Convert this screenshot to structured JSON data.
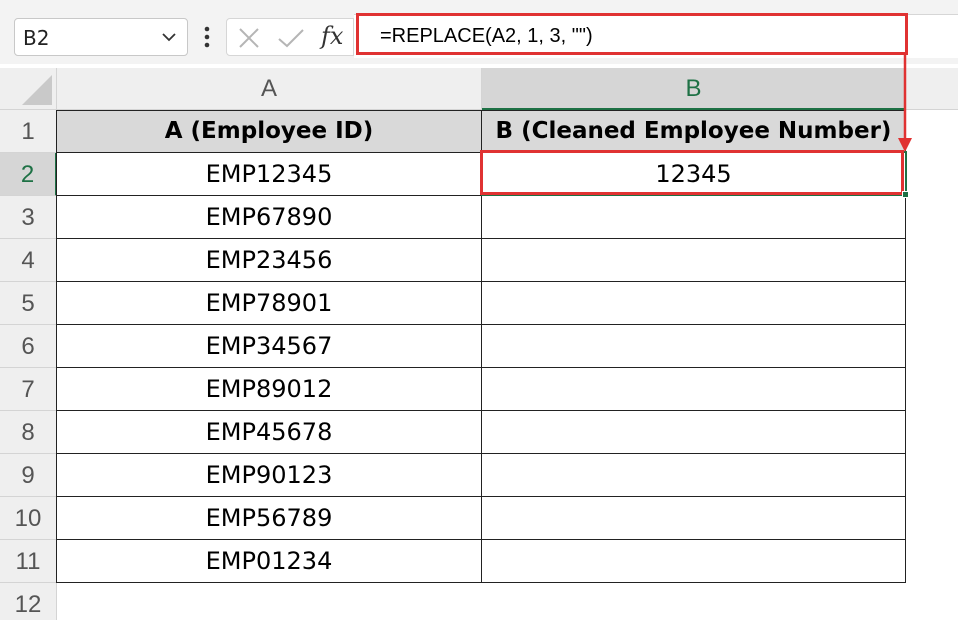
{
  "name_box": {
    "value": "B2"
  },
  "formula_bar": {
    "fx_label": "fx",
    "formula": "=REPLACE(A2, 1, 3, \"\")"
  },
  "columns": [
    "A",
    "B"
  ],
  "rows": [
    "1",
    "2",
    "3",
    "4",
    "5",
    "6",
    "7",
    "8",
    "9",
    "10",
    "11",
    "12"
  ],
  "table": {
    "headers": [
      "A (Employee ID)",
      "B (Cleaned Employee Number)"
    ],
    "rows": [
      [
        "EMP12345",
        "12345"
      ],
      [
        "EMP67890",
        ""
      ],
      [
        "EMP23456",
        ""
      ],
      [
        "EMP78901",
        ""
      ],
      [
        "EMP34567",
        ""
      ],
      [
        "EMP89012",
        ""
      ],
      [
        "EMP45678",
        ""
      ],
      [
        "EMP90123",
        ""
      ],
      [
        "EMP56789",
        ""
      ],
      [
        "EMP01234",
        ""
      ]
    ]
  },
  "colors": {
    "highlight": "#e03232",
    "selection": "#1e7145",
    "header_fill": "#d9d9d9"
  },
  "active_cell": "B2"
}
